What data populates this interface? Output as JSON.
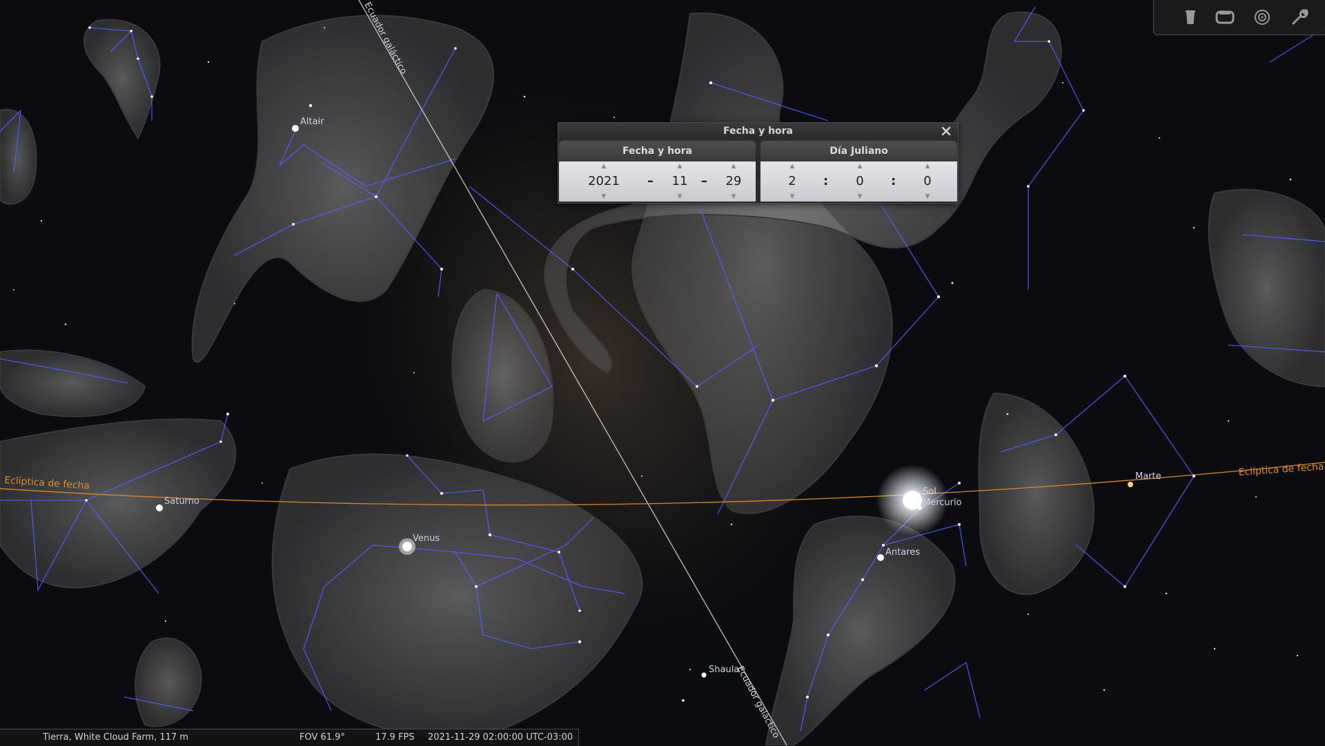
{
  "sky": {
    "labels": {
      "altair": "Altair",
      "saturno": "Saturno",
      "venus": "Venus",
      "sol": "Sol",
      "mercurio": "Mercurio",
      "antares": "Antares",
      "marte": "Marte",
      "shaula": "Shaula"
    },
    "galactic_equator_label": "Ecuador galáctico",
    "ecliptic_label": "Eclíptica de fecha"
  },
  "toolbar": {
    "icons": [
      "trash-icon",
      "window-icon",
      "target-icon",
      "wrench-icon"
    ]
  },
  "dialog": {
    "title": "Fecha y hora",
    "tab_date": "Fecha y hora",
    "tab_julian": "Día Juliano",
    "year": "2021",
    "month": "11",
    "day": "29",
    "hour": "2",
    "minute": "0",
    "second": "0",
    "date_separator": "–",
    "time_separator": ":"
  },
  "status_bar": {
    "location": "Tierra, White Cloud Farm, 117 m",
    "fov": "FOV 61.9°",
    "fps": "17.9 FPS",
    "datetime": "2021-11-29 02:00:00 UTC-03:00"
  },
  "colors": {
    "constellation_lines": "#5a5cff",
    "ecliptic": "#e08a2e",
    "galactic_equator": "#d8d8d8",
    "sky_background": "#0b0c10"
  }
}
